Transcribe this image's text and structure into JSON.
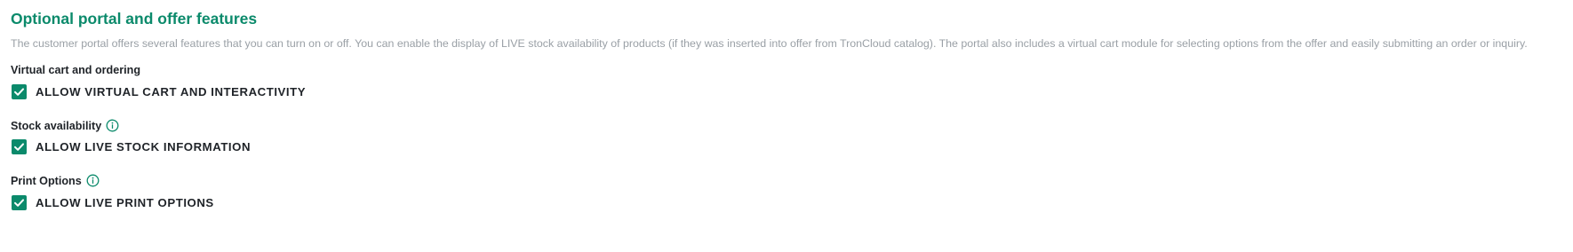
{
  "page": {
    "title": "Optional portal and offer features",
    "description": "The customer portal offers several features that you can turn on or off. You can enable the display of LIVE stock availability of products (if they was inserted into offer from TronCloud catalog). The portal also includes a virtual cart module for selecting options from the offer and easily submitting an order or inquiry."
  },
  "sections": [
    {
      "label": "Virtual cart and ordering",
      "has_info_icon": false,
      "option_label": "ALLOW VIRTUAL CART AND INTERACTIVITY",
      "checked": true
    },
    {
      "label": "Stock availability",
      "has_info_icon": true,
      "info_icon": "info-circle-icon",
      "option_label": "ALLOW LIVE STOCK INFORMATION",
      "checked": true
    },
    {
      "label": "Print Options",
      "has_info_icon": true,
      "info_icon": "info-circle-icon",
      "option_label": "ALLOW LIVE PRINT OPTIONS",
      "checked": true
    }
  ],
  "colors": {
    "accent": "#0b8a6b",
    "description_text": "#9aa0a6",
    "body_text": "#1f2328"
  }
}
